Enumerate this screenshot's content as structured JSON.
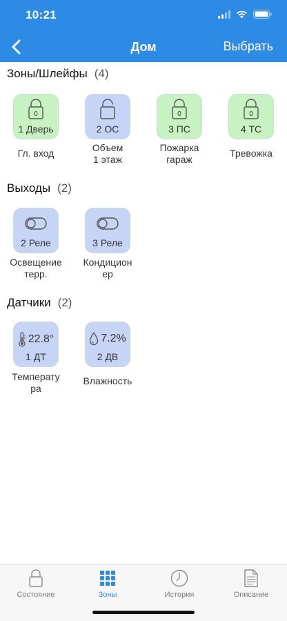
{
  "status": {
    "time": "10:21"
  },
  "nav": {
    "title": "Дом",
    "action": "Выбрать"
  },
  "zones": {
    "header": "Зоны/Шлейфы",
    "count": "(4)",
    "items": [
      {
        "num": "0",
        "label": "1 Дверь",
        "caption": "Гл. вход",
        "state": "locked",
        "color": "green"
      },
      {
        "num": "",
        "label": "2 ОС",
        "caption": "Объем\n1 этаж",
        "state": "unlocked",
        "color": "blue"
      },
      {
        "num": "0",
        "label": "3 ПС",
        "caption": "Пожарка\nгараж",
        "state": "locked",
        "color": "green"
      },
      {
        "num": "0",
        "label": "4 ТС",
        "caption": "Тревожка",
        "state": "locked",
        "color": "green"
      }
    ]
  },
  "outputs": {
    "header": "Выходы",
    "count": "(2)",
    "items": [
      {
        "label": "2 Реле",
        "caption": "Освещение\nтерр."
      },
      {
        "label": "3 Реле",
        "caption": "Кондицион\nер"
      }
    ]
  },
  "sensors": {
    "header": "Датчики",
    "count": "(2)",
    "items": [
      {
        "value": "22.8°",
        "label": "1 ДТ",
        "caption": "Температу\nра",
        "icon": "thermometer-icon"
      },
      {
        "value": "7.2%",
        "label": "2 ДВ",
        "caption": "Влажность",
        "icon": "droplet-icon"
      }
    ]
  },
  "tabs": [
    {
      "label": "Состояние",
      "icon": "lock-icon"
    },
    {
      "label": "Зоны",
      "icon": "grid-icon"
    },
    {
      "label": "История",
      "icon": "clock-icon"
    },
    {
      "label": "Описание",
      "icon": "document-icon"
    }
  ],
  "colors": {
    "accent": "#2d8be6",
    "green_tile": "#c9f2c2",
    "blue_tile": "#c6d4f6"
  }
}
